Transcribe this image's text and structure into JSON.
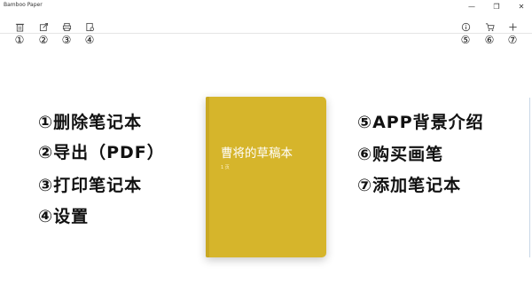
{
  "window": {
    "title": "Bamboo Paper",
    "minimize_glyph": "—",
    "maximize_glyph": "❐",
    "close_glyph": "✕"
  },
  "toolbar": {
    "left_markers": [
      "①",
      "②",
      "③",
      "④"
    ],
    "right_markers": [
      "⑤",
      "⑥",
      "⑦"
    ],
    "left_icons": [
      "delete-icon",
      "export-icon",
      "print-icon",
      "settings-icon"
    ],
    "right_icons": [
      "info-icon",
      "cart-icon",
      "add-icon"
    ]
  },
  "annotations": {
    "left": [
      "①删除笔记本",
      "②导出（PDF）",
      "③打印笔记本",
      "④设置"
    ],
    "right": [
      "⑤APP背景介绍",
      "⑥购买画笔",
      "⑦添加笔记本"
    ]
  },
  "notebook": {
    "title": "曹将的草稿本",
    "subtitle": "1 页",
    "color": "#d6b52b"
  }
}
